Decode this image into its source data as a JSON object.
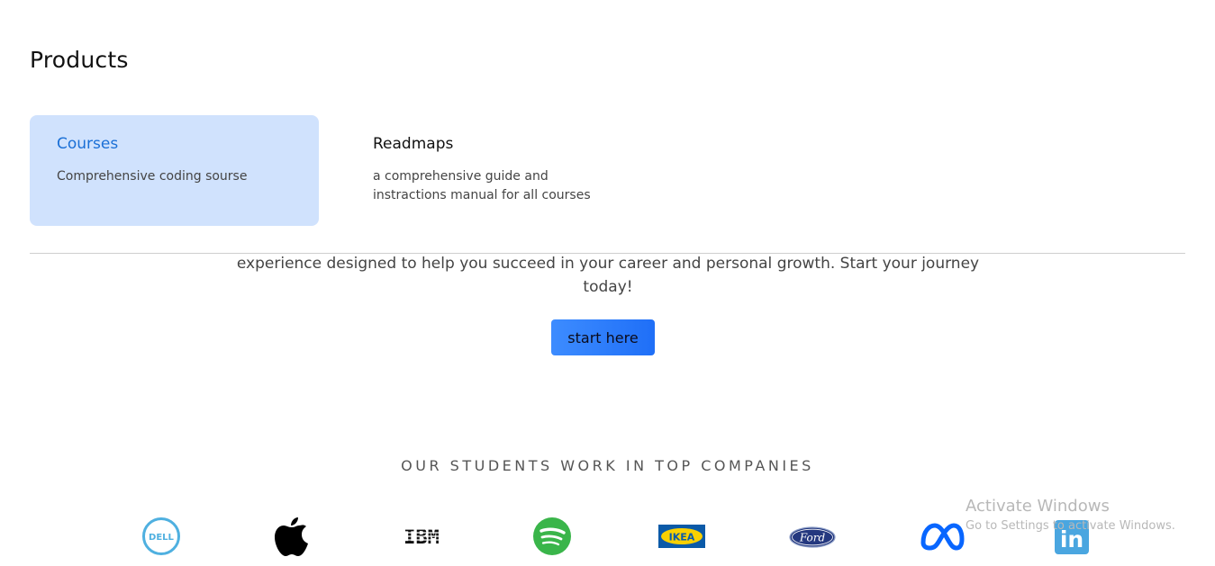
{
  "products": {
    "title": "Products",
    "cards": [
      {
        "title": "Courses",
        "description": "Comprehensive coding sourse"
      },
      {
        "title": "Readmaps",
        "description": "a comprehensive guide and instractions manual for all courses"
      }
    ]
  },
  "hero": {
    "text": "experience designed to help you succeed in your career and personal growth. Start your journey today!",
    "cta_label": "start here"
  },
  "companies": {
    "heading": "OUR STUDENTS WORK IN TOP COMPANIES",
    "logos": [
      {
        "name": "Dell",
        "text": "DELL",
        "color": "#4fb0e0"
      },
      {
        "name": "Apple",
        "color": "#000000"
      },
      {
        "name": "IBM",
        "text": "IBM",
        "color": "#111111"
      },
      {
        "name": "Spotify",
        "color": "#3ab54a"
      },
      {
        "name": "IKEA",
        "text": "IKEA",
        "color": "#0b5aa8"
      },
      {
        "name": "Ford",
        "text": "Ford",
        "color": "#24387f"
      },
      {
        "name": "Meta",
        "color": "#0866ff"
      },
      {
        "name": "LinkedIn",
        "text": "in",
        "color": "#4aa6e0"
      }
    ]
  },
  "watermark": {
    "title": "Activate Windows",
    "subtitle": "Go to Settings to activate Windows."
  }
}
